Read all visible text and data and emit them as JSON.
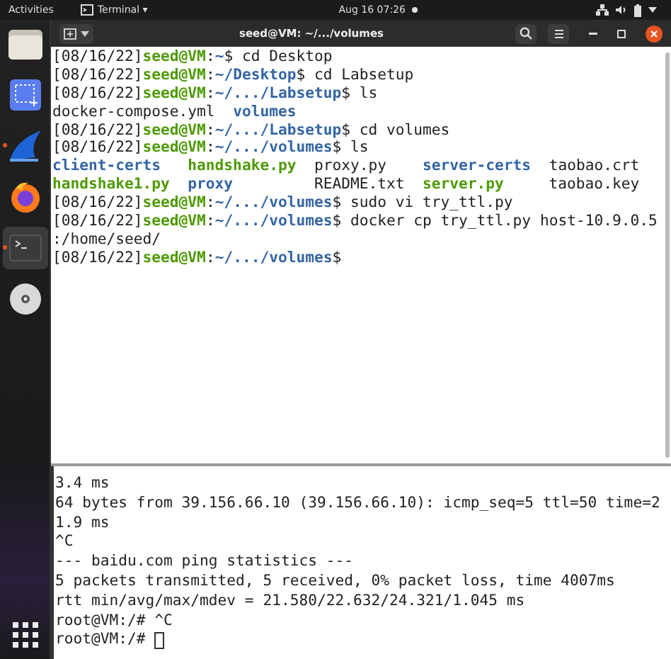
{
  "top_bar": {
    "activities": "Activities",
    "app_menu": "Terminal ▾",
    "clock": "Aug 16  07:26"
  },
  "dock": {
    "items": [
      {
        "kind": "files",
        "selected": false,
        "running": false
      },
      {
        "kind": "screenshot",
        "selected": false,
        "running": false
      },
      {
        "kind": "wireshark",
        "selected": false,
        "running": true
      },
      {
        "kind": "firefox",
        "selected": false,
        "running": false
      },
      {
        "kind": "terminal",
        "selected": true,
        "running": true
      },
      {
        "kind": "disc",
        "selected": false,
        "running": false
      }
    ]
  },
  "window": {
    "title": "seed@VM: ~/.../volumes"
  },
  "terminal": {
    "lines": [
      [
        {
          "kind": "plain",
          "text": "[08/16/22]"
        },
        {
          "kind": "user",
          "text": "seed@VM"
        },
        {
          "kind": "plain",
          "text": ":"
        },
        {
          "kind": "path",
          "text": "~"
        },
        {
          "kind": "plain",
          "text": "$ cd Desktop"
        }
      ],
      [
        {
          "kind": "plain",
          "text": "[08/16/22]"
        },
        {
          "kind": "user",
          "text": "seed@VM"
        },
        {
          "kind": "plain",
          "text": ":"
        },
        {
          "kind": "path",
          "text": "~/Desktop"
        },
        {
          "kind": "plain",
          "text": "$ cd Labsetup"
        }
      ],
      [
        {
          "kind": "plain",
          "text": "[08/16/22]"
        },
        {
          "kind": "user",
          "text": "seed@VM"
        },
        {
          "kind": "plain",
          "text": ":"
        },
        {
          "kind": "path",
          "text": "~/.../Labsetup"
        },
        {
          "kind": "plain",
          "text": "$ ls"
        }
      ],
      [
        {
          "kind": "plain",
          "text": "docker-compose.yml  "
        },
        {
          "kind": "dir",
          "text": "volumes"
        }
      ],
      [
        {
          "kind": "plain",
          "text": "[08/16/22]"
        },
        {
          "kind": "user",
          "text": "seed@VM"
        },
        {
          "kind": "plain",
          "text": ":"
        },
        {
          "kind": "path",
          "text": "~/.../Labsetup"
        },
        {
          "kind": "plain",
          "text": "$ cd volumes"
        }
      ],
      [
        {
          "kind": "plain",
          "text": "[08/16/22]"
        },
        {
          "kind": "user",
          "text": "seed@VM"
        },
        {
          "kind": "plain",
          "text": ":"
        },
        {
          "kind": "path",
          "text": "~/.../volumes"
        },
        {
          "kind": "plain",
          "text": "$ ls"
        }
      ],
      [
        {
          "kind": "dir",
          "text": "client-certs   "
        },
        {
          "kind": "exec",
          "text": "handshake.py"
        },
        {
          "kind": "plain",
          "text": "  proxy.py    "
        },
        {
          "kind": "dir",
          "text": "server-certs"
        },
        {
          "kind": "plain",
          "text": "  taobao.crt"
        }
      ],
      [
        {
          "kind": "exec",
          "text": "handshake1.py  "
        },
        {
          "kind": "dir",
          "text": "proxy"
        },
        {
          "kind": "plain",
          "text": "         README.txt  "
        },
        {
          "kind": "exec",
          "text": "server.py"
        },
        {
          "kind": "plain",
          "text": "     taobao.key"
        }
      ],
      [
        {
          "kind": "plain",
          "text": "[08/16/22]"
        },
        {
          "kind": "user",
          "text": "seed@VM"
        },
        {
          "kind": "plain",
          "text": ":"
        },
        {
          "kind": "path",
          "text": "~/.../volumes"
        },
        {
          "kind": "plain",
          "text": "$ sudo vi try_ttl.py"
        }
      ],
      [
        {
          "kind": "plain",
          "text": "[08/16/22]"
        },
        {
          "kind": "user",
          "text": "seed@VM"
        },
        {
          "kind": "plain",
          "text": ":"
        },
        {
          "kind": "path",
          "text": "~/.../volumes"
        },
        {
          "kind": "plain",
          "text": "$ docker cp try_ttl.py host-10.9.0.5"
        }
      ],
      [
        {
          "kind": "plain",
          "text": ":/home/seed/"
        }
      ],
      [
        {
          "kind": "plain",
          "text": "[08/16/22]"
        },
        {
          "kind": "user",
          "text": "seed@VM"
        },
        {
          "kind": "plain",
          "text": ":"
        },
        {
          "kind": "path",
          "text": "~/.../volumes"
        },
        {
          "kind": "plain",
          "text": "$"
        }
      ]
    ]
  },
  "back_terminal": {
    "lines": [
      "3.4 ms",
      "64 bytes from 39.156.66.10 (39.156.66.10): icmp_seq=5 ttl=50 time=2",
      "1.9 ms",
      "^C",
      "--- baidu.com ping statistics ---",
      "5 packets transmitted, 5 received, 0% packet loss, time 4007ms",
      "rtt min/avg/max/mdev = 21.580/22.632/24.321/1.045 ms",
      "root@VM:/# ^C",
      "root@VM:/# "
    ]
  }
}
